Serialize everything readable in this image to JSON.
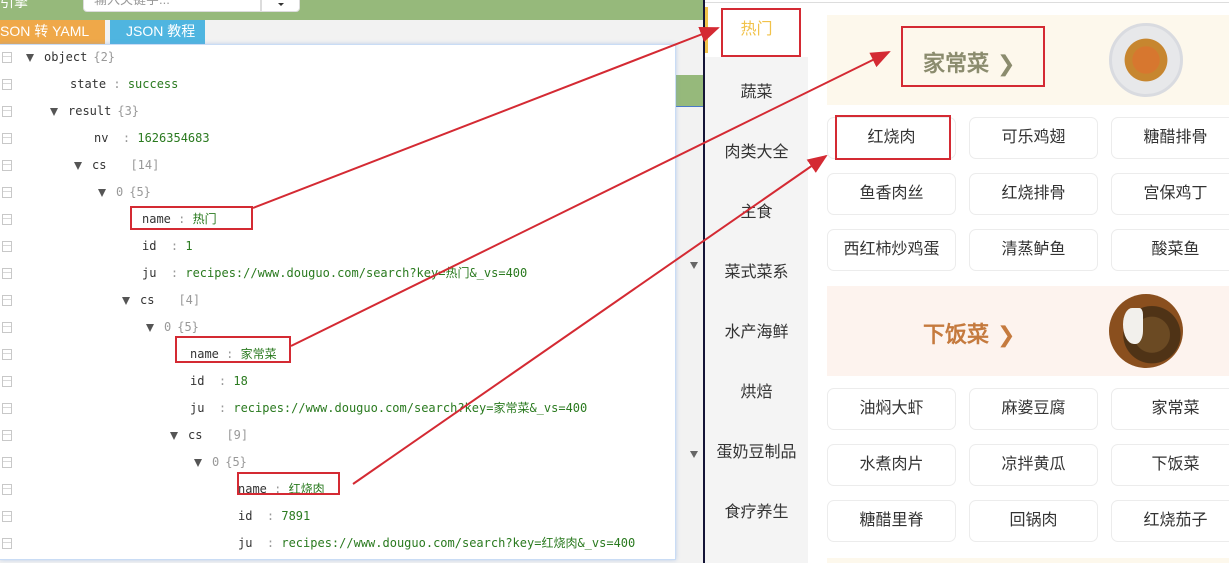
{
  "toolbar": {
    "label": "引擎",
    "search_placeholder": "输入关键字..."
  },
  "tabs": [
    {
      "label": "SON 转 YAML"
    },
    {
      "label": "JSON 教程"
    }
  ],
  "json_tree": {
    "rows": [
      {
        "key": "object",
        "meta": "{2}",
        "expandable": true
      },
      {
        "key": "state",
        "value": "success"
      },
      {
        "key": "result",
        "meta": "{3}",
        "expandable": true
      },
      {
        "key": "nv",
        "value": "1626354683"
      },
      {
        "key": "cs",
        "meta": "[14]",
        "expandable": true
      },
      {
        "key": "0",
        "meta": "{5}",
        "expandable": true
      },
      {
        "key": "name",
        "value": "热门",
        "highlighted": true
      },
      {
        "key": "id",
        "value": "1"
      },
      {
        "key": "ju",
        "value": "recipes://www.douguo.com/search?key=热门&_vs=400"
      },
      {
        "key": "cs",
        "meta": "[4]",
        "expandable": true
      },
      {
        "key": "0",
        "meta": "{5}",
        "expandable": true
      },
      {
        "key": "name",
        "value": "家常菜",
        "highlighted": true
      },
      {
        "key": "id",
        "value": "18"
      },
      {
        "key": "ju",
        "value": "recipes://www.douguo.com/search?key=家常菜&_vs=400"
      },
      {
        "key": "cs",
        "meta": "[9]",
        "expandable": true
      },
      {
        "key": "0",
        "meta": "{5}",
        "expandable": true
      },
      {
        "key": "name",
        "value": "红烧肉",
        "highlighted": true
      },
      {
        "key": "id",
        "value": "7891"
      },
      {
        "key": "ju",
        "value": "recipes://www.douguo.com/search?key=红烧肉&_vs=400"
      }
    ]
  },
  "categories": [
    {
      "label": "热门",
      "active": true
    },
    {
      "label": "蔬菜"
    },
    {
      "label": "肉类大全"
    },
    {
      "label": "主食"
    },
    {
      "label": "菜式菜系"
    },
    {
      "label": "水产海鲜"
    },
    {
      "label": "烘焙"
    },
    {
      "label": "蛋奶豆制品"
    },
    {
      "label": "食疗养生"
    }
  ],
  "sections": [
    {
      "title": "家常菜",
      "chevron": "❯",
      "title_color": "#8b8c6e",
      "tags": [
        "红烧肉",
        "可乐鸡翅",
        "糖醋排骨",
        "鱼香肉丝",
        "红烧排骨",
        "宫保鸡丁",
        "西红柿炒鸡蛋",
        "清蒸鲈鱼",
        "酸菜鱼"
      ]
    },
    {
      "title": "下饭菜",
      "chevron": "❯",
      "title_color": "#c57a3e",
      "tags": [
        "油焖大虾",
        "麻婆豆腐",
        "家常菜",
        "水煮肉片",
        "凉拌黄瓜",
        "下饭菜",
        "糖醋里脊",
        "回锅肉",
        "红烧茄子"
      ]
    }
  ],
  "colors": {
    "accent_yellow": "#f1c24a",
    "annotation_red": "#d42a33",
    "json_value_green": "#2a7a1f",
    "toolbar_green": "#96b97b",
    "tab_orange": "#efa849",
    "tab_blue": "#4fb5e0"
  }
}
